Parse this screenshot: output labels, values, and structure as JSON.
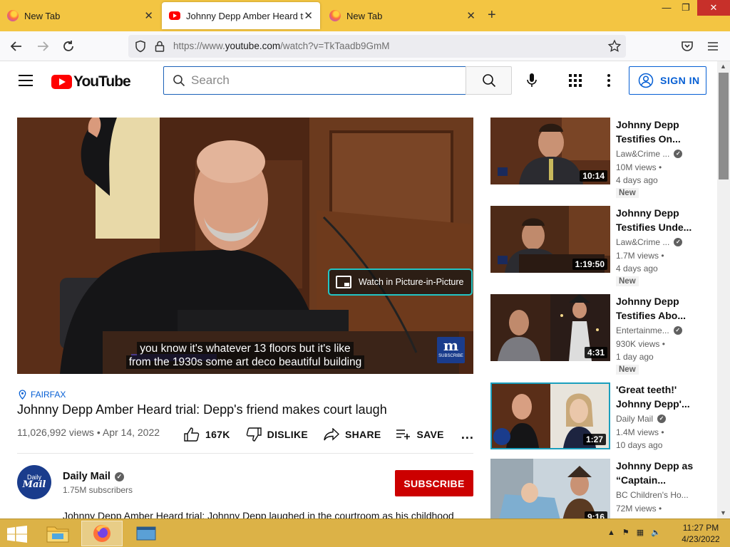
{
  "browser": {
    "tabs": [
      {
        "title": "New Tab",
        "favicon": "firefox-icon",
        "active": false
      },
      {
        "title": "Johnny Depp Amber Heard trial",
        "favicon": "youtube-icon",
        "active": true
      },
      {
        "title": "New Tab",
        "favicon": "firefox-icon",
        "active": false
      }
    ],
    "new_tab_glyph": "+",
    "url_prefix": "https://www.",
    "url_domain": "youtube.com",
    "url_path": "/watch?v=TkTaadb9GmM"
  },
  "youtube": {
    "logo_text": "YouTube",
    "search_placeholder": "Search",
    "sign_in_label": "SIGN IN",
    "brand_color": "#ff0000",
    "link_color": "#065fd4"
  },
  "video": {
    "pip_label": "Watch in Picture-in-Picture",
    "caption_line1": "you know it's whatever 13 floors but it's like",
    "caption_line2": "from the 1930s some art deco beautiful building",
    "watermark_letter": "m",
    "watermark_sub": "SUBSCRIBE",
    "location": "FAIRFAX",
    "title": "Johnny Depp Amber Heard trial: Depp's friend makes court laugh",
    "views": "11,026,992 views",
    "date": "Apr 14, 2022",
    "likes": "167K",
    "dislike_label": "DISLIKE",
    "share_label": "SHARE",
    "save_label": "SAVE",
    "more_glyph": "..."
  },
  "channel": {
    "name": "Daily Mail",
    "subscribers": "1.75M subscribers",
    "avatar_line1": "Daily",
    "avatar_line2": "Mail",
    "subscribe_label": "SUBSCRIBE",
    "description": "Johnny Depp Amber Heard trial: Johnny Depp laughed in the courtroom as his childhood"
  },
  "recommendations": [
    {
      "title": "Johnny Depp Testifies On...",
      "channel": "Law&Crime ...",
      "views": "10M views",
      "age": "4 days ago",
      "badge": "New",
      "duration": "10:14"
    },
    {
      "title": "Johnny Depp Testifies Unde...",
      "channel": "Law&Crime ...",
      "views": "1.7M views",
      "age": "4 days ago",
      "badge": "New",
      "duration": "1:19:50"
    },
    {
      "title": "Johnny Depp Testifies Abo...",
      "channel": "Entertainme...",
      "views": "930K views",
      "age": "1 day ago",
      "badge": "New",
      "duration": "4:31"
    },
    {
      "title": "'Great teeth!' Johnny Depp'...",
      "channel": "Daily Mail",
      "views": "1.4M views",
      "age": "10 days ago",
      "badge": "",
      "duration": "1:27"
    },
    {
      "title": "Johnny Depp as “Captain...",
      "channel": "BC Children's Ho...",
      "views": "72M views",
      "age": "",
      "badge": "",
      "duration": "9:16"
    }
  ],
  "taskbar": {
    "time": "11:27 PM",
    "date": "4/23/2022"
  }
}
